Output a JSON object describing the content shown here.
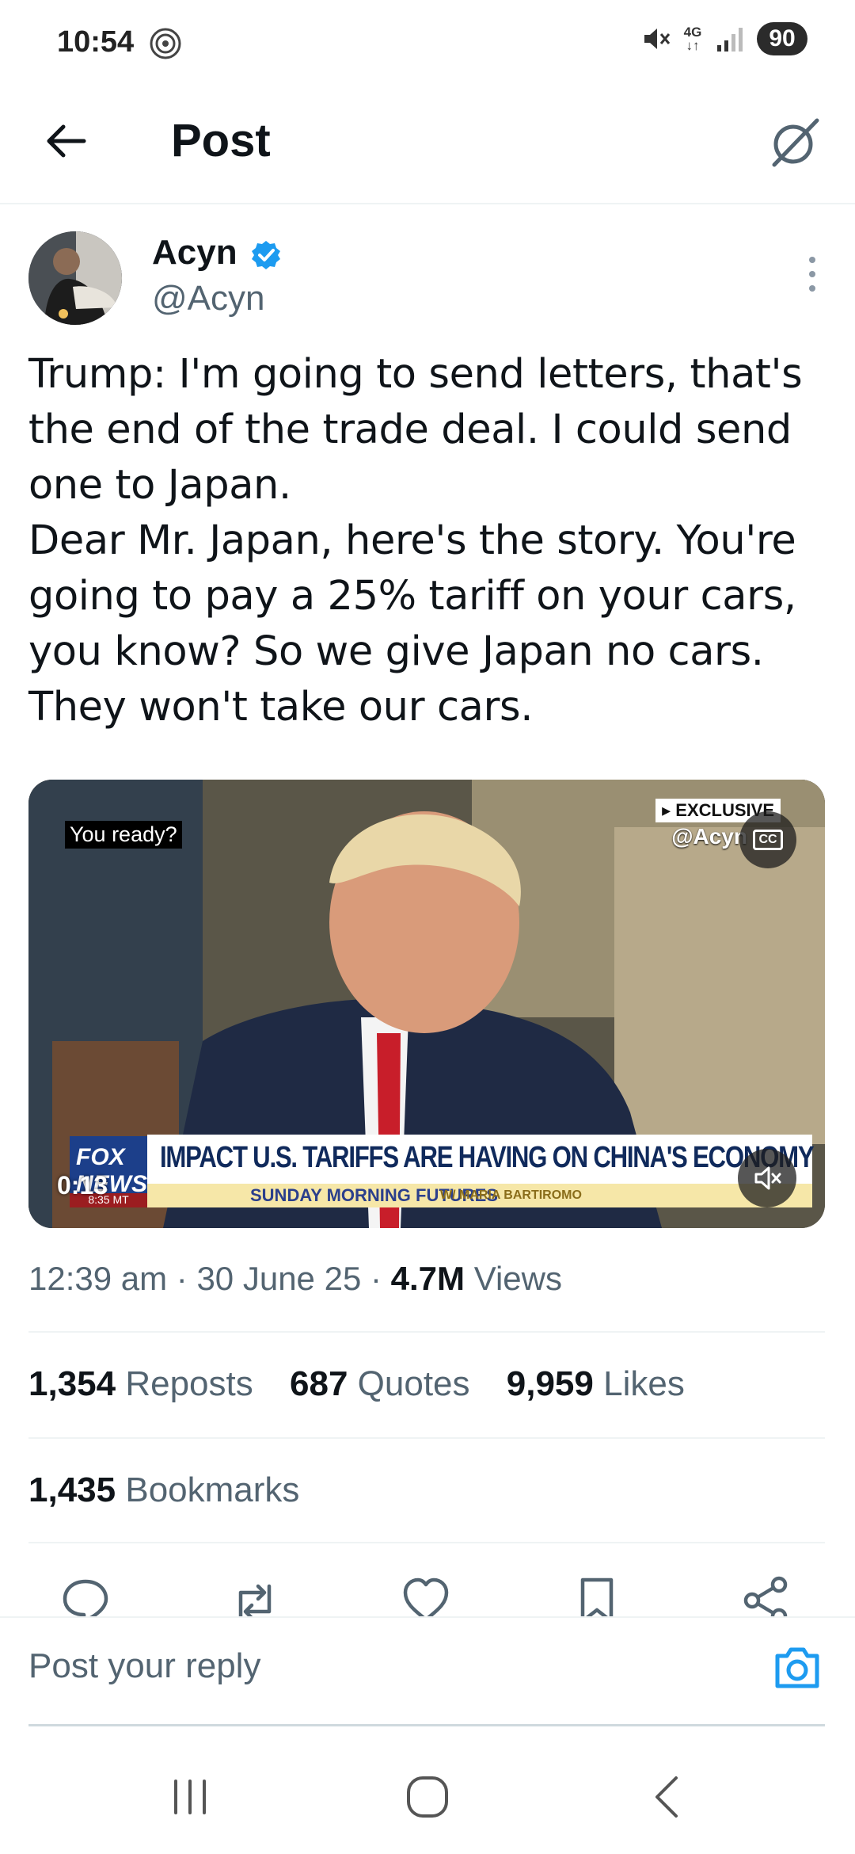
{
  "status_bar": {
    "time": "10:54",
    "network": "4G",
    "battery": "90"
  },
  "header": {
    "title": "Post"
  },
  "author": {
    "name": "Acyn",
    "handle": "@Acyn",
    "verified_color": "#1d9bf0"
  },
  "tweet": {
    "text": "Trump: I'm going to send letters, that's the end of the trade deal. I could send one to Japan.\nDear Mr. Japan, here's the story. You're going to pay a 25% tariff on your cars, you know? So we give Japan no cars. They won't take our cars."
  },
  "video": {
    "caption": "You ready?",
    "exclusive": "▸ EXCLUSIVE",
    "watermark": "@Acyn",
    "cc": "CC",
    "headline": "IMPACT U.S. TARIFFS ARE HAVING ON CHINA'S ECONOMY",
    "show_name": "SUNDAY MORNING FUTURES",
    "host": "W/ MARIA BARTIROMO",
    "network_logo": "FOX NEWS",
    "network_time": "8:35 MT",
    "elapsed": "0:13"
  },
  "meta": {
    "time": "12:39 am",
    "date": "30 June 25",
    "views_count": "4.7M",
    "views_label": "Views"
  },
  "stats": {
    "reposts_count": "1,354",
    "reposts_label": "Reposts",
    "quotes_count": "687",
    "quotes_label": "Quotes",
    "likes_count": "9,959",
    "likes_label": "Likes",
    "bookmarks_count": "1,435",
    "bookmarks_label": "Bookmarks"
  },
  "reply": {
    "placeholder": "Post your reply",
    "accent": "#1d9bf0"
  },
  "icons": {
    "back": "arrow-left-icon",
    "grok": "grok-icon",
    "more": "more-vertical-icon",
    "reply": "comment-icon",
    "repost": "repost-icon",
    "like": "heart-icon",
    "bookmark": "bookmark-icon",
    "share": "share-icon",
    "camera": "camera-icon"
  }
}
